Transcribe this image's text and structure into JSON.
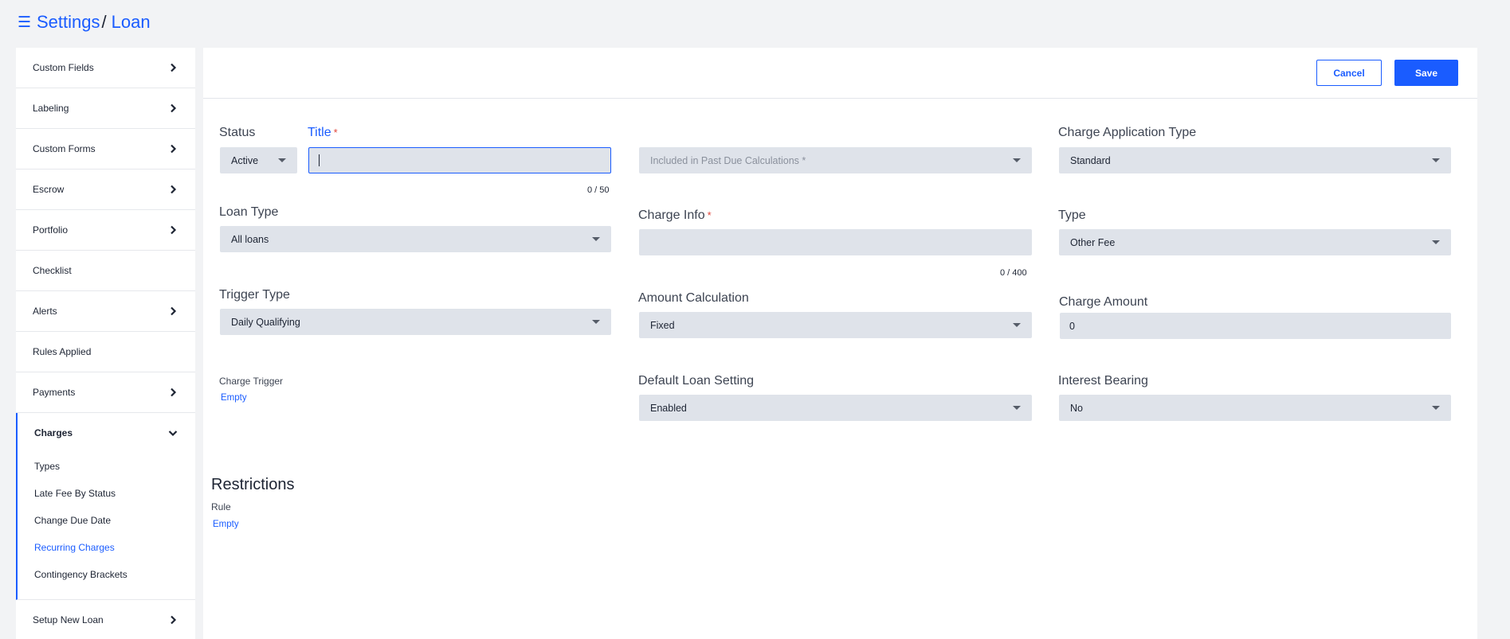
{
  "header": {
    "breadcrumb_root": "Settings",
    "breadcrumb_sep": "/",
    "breadcrumb_current": "Loan"
  },
  "sidebar": {
    "items_top": [
      {
        "label": "Custom Fields",
        "has_chevron": true
      },
      {
        "label": "Labeling",
        "has_chevron": true
      },
      {
        "label": "Custom Forms",
        "has_chevron": true
      },
      {
        "label": "Escrow",
        "has_chevron": true
      },
      {
        "label": "Portfolio",
        "has_chevron": true
      },
      {
        "label": "Checklist",
        "has_chevron": false
      },
      {
        "label": "Alerts",
        "has_chevron": true
      },
      {
        "label": "Rules Applied",
        "has_chevron": false
      },
      {
        "label": "Payments",
        "has_chevron": true
      }
    ],
    "group": {
      "label": "Charges",
      "subitems": [
        {
          "label": "Types",
          "active": false
        },
        {
          "label": "Late Fee By Status",
          "active": false
        },
        {
          "label": "Change Due Date",
          "active": false
        },
        {
          "label": "Recurring Charges",
          "active": true
        },
        {
          "label": "Contingency Brackets",
          "active": false
        }
      ]
    },
    "items_bottom": [
      {
        "label": "Setup New Loan",
        "has_chevron": true
      }
    ]
  },
  "toolbar": {
    "cancel_label": "Cancel",
    "save_label": "Save"
  },
  "form": {
    "status": {
      "label": "Status",
      "value": "Active"
    },
    "title": {
      "label": "Title",
      "required": "*",
      "value": "",
      "counter": "0 / 50"
    },
    "past_due": {
      "placeholder": "Included in Past Due Calculations *"
    },
    "charge_application_type": {
      "label": "Charge Application Type",
      "value": "Standard"
    },
    "loan_type": {
      "label": "Loan Type",
      "value": "All loans"
    },
    "charge_info": {
      "label": "Charge Info",
      "required": "*",
      "value": "",
      "counter": "0 / 400"
    },
    "type": {
      "label": "Type",
      "value": "Other Fee"
    },
    "trigger_type": {
      "label": "Trigger Type",
      "value": "Daily Qualifying"
    },
    "amount_calculation": {
      "label": "Amount Calculation",
      "value": "Fixed"
    },
    "charge_amount": {
      "label": "Charge Amount",
      "value": "0"
    },
    "charge_trigger": {
      "label": "Charge Trigger",
      "value": "Empty"
    },
    "default_loan_setting": {
      "label": "Default Loan Setting",
      "value": "Enabled"
    },
    "interest_bearing": {
      "label": "Interest Bearing",
      "value": "No"
    }
  },
  "restrictions": {
    "title": "Restrictions",
    "rule_label": "Rule",
    "rule_value": "Empty"
  },
  "colors": {
    "accent": "#1a5cff",
    "field_bg": "#dfe3ea",
    "page_bg": "#f2f3f5"
  }
}
